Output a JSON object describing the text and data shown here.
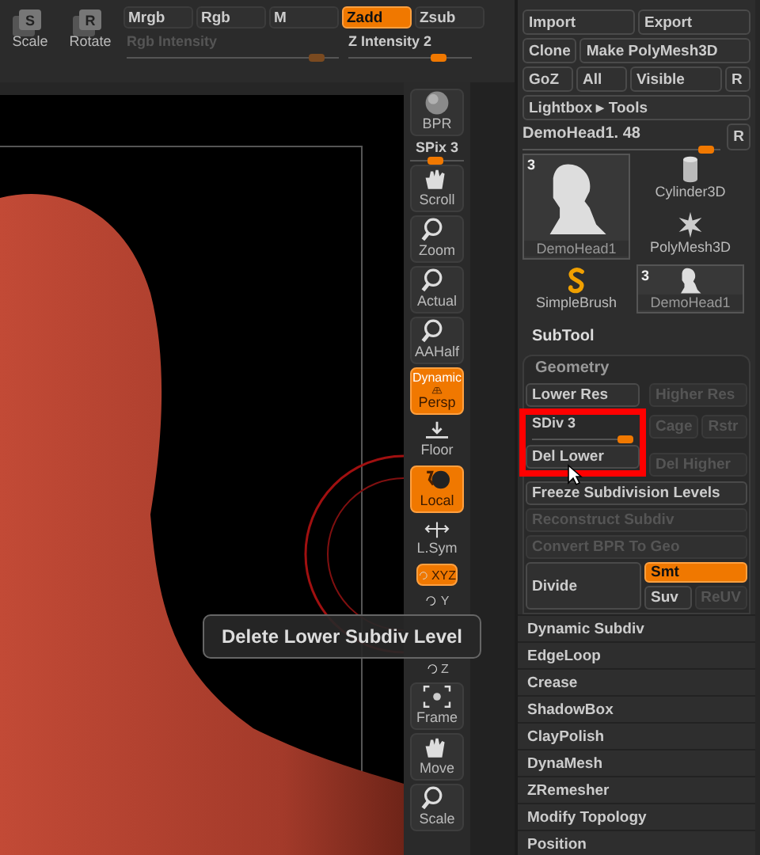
{
  "top_bar": {
    "transform_buttons": [
      {
        "key": "S",
        "label": "Scale"
      },
      {
        "key": "R",
        "label": "Rotate"
      }
    ],
    "modes": [
      {
        "label": "Mrgb",
        "selected": false
      },
      {
        "label": "Rgb",
        "selected": false
      },
      {
        "label": "M",
        "selected": false
      },
      {
        "label": "Zadd",
        "selected": true
      },
      {
        "label": "Zsub",
        "selected": false
      }
    ],
    "sliders": [
      {
        "label": "Rgb Intensity",
        "disabled": true,
        "level": 0.93
      },
      {
        "label": "Z Intensity 2",
        "disabled": false,
        "level": 0.8
      }
    ]
  },
  "shelf": {
    "buttons": [
      {
        "kind": "big",
        "label": "BPR",
        "on": false
      },
      {
        "kind": "slider",
        "label": "SPix 3",
        "level": 0.5
      },
      {
        "kind": "big",
        "label": "Scroll",
        "on": false
      },
      {
        "kind": "big",
        "label": "Zoom",
        "on": false
      },
      {
        "kind": "big",
        "label": "Actual",
        "on": false
      },
      {
        "kind": "big",
        "label": "AAHalf",
        "on": false
      },
      {
        "kind": "big",
        "label": "Persp",
        "sublabel": "Dynamic",
        "on": true
      },
      {
        "kind": "flat",
        "label": "Floor",
        "on": false
      },
      {
        "kind": "big",
        "label": "Local",
        "on": true
      },
      {
        "kind": "flat",
        "label": "L.Sym",
        "on": false
      },
      {
        "kind": "small",
        "label": "XYZ",
        "on": true
      },
      {
        "kind": "small",
        "label": "Y",
        "on": false
      },
      {
        "kind": "small",
        "label": "Z",
        "on": false
      },
      {
        "kind": "big",
        "label": "Frame",
        "on": false
      },
      {
        "kind": "big",
        "label": "Move",
        "on": false
      },
      {
        "kind": "big",
        "label": "Scale",
        "on": false
      }
    ]
  },
  "tooltip": "Delete Lower Subdiv Level",
  "tool_panel": {
    "rows": [
      [
        {
          "label": "Import"
        },
        {
          "label": "Export"
        }
      ],
      [
        {
          "label": "Clone"
        },
        {
          "label": "Make PolyMesh3D"
        }
      ],
      [
        {
          "label": "GoZ"
        },
        {
          "label": "All"
        },
        {
          "label": "Visible"
        },
        {
          "label": "R"
        }
      ],
      [
        {
          "label": "Lightbox ▸ Tools"
        }
      ]
    ],
    "current_tool": {
      "label": "DemoHead1. 48",
      "level": 0.97,
      "button": "R"
    },
    "tools": [
      {
        "label": "DemoHead1",
        "badge": "3",
        "selected": true
      },
      {
        "label": "Cylinder3D",
        "selected": false
      },
      {
        "label": "PolyMesh3D",
        "selected": false
      },
      {
        "label": "SimpleBrush",
        "selected": false
      },
      {
        "label": "DemoHead1",
        "badge": "3",
        "selected": false
      }
    ]
  },
  "subtool": {
    "title": "SubTool"
  },
  "geometry": {
    "title": "Geometry",
    "res_buttons": [
      {
        "label": "Lower Res",
        "disabled": false
      },
      {
        "label": "Higher Res",
        "disabled": true
      }
    ],
    "sdiv": {
      "label": "SDiv 3",
      "level": 1.0
    },
    "cage_buttons": [
      {
        "label": "Cage",
        "disabled": true
      },
      {
        "label": "Rstr",
        "disabled": true
      }
    ],
    "del_buttons": [
      {
        "label": "Del Lower",
        "disabled": false
      },
      {
        "label": "Del Higher",
        "disabled": true
      }
    ],
    "wide_buttons": [
      {
        "label": "Freeze Subdivision Levels",
        "disabled": false
      },
      {
        "label": "Reconstruct Subdiv",
        "disabled": true
      },
      {
        "label": "Convert BPR To Geo",
        "disabled": true
      }
    ],
    "divide": {
      "label": "Divide"
    },
    "smt": {
      "label": "Smt",
      "on": true
    },
    "uv_buttons": [
      {
        "label": "Suv",
        "disabled": false
      },
      {
        "label": "ReUV",
        "disabled": true
      }
    ]
  },
  "subpalettes": [
    "Dynamic Subdiv",
    "EdgeLoop",
    "Crease",
    "ShadowBox",
    "ClayPolish",
    "DynaMesh",
    "ZRemesher",
    "Modify Topology",
    "Position"
  ]
}
